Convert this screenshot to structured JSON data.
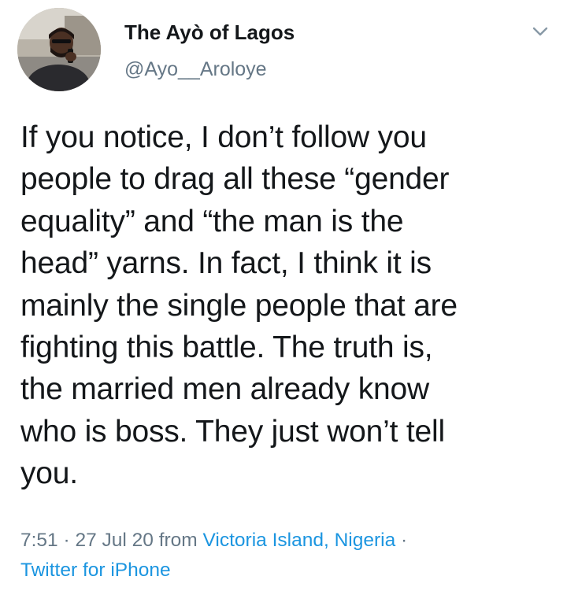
{
  "user": {
    "display_name": "The Ayò of Lagos",
    "handle": "@Ayo__Aroloye"
  },
  "tweet": {
    "lines": [
      "If you notice, I don’t follow you",
      "people to drag all these “gender",
      "equality” and “the man is the",
      "head” yarns. In fact, I think it is",
      "mainly the single people that are",
      "fighting this battle. The truth is,",
      "the married men already know",
      "who is boss. They just won’t tell",
      "you."
    ]
  },
  "meta": {
    "time": "7:51",
    "sep1": " · ",
    "date": "27 Jul 20",
    "from_text": " from ",
    "location": "Victoria Island, Nigeria",
    "sep2": " ·",
    "client": "Twitter for iPhone"
  },
  "icons": {
    "menu": "chevron-down-icon"
  },
  "colors": {
    "text": "#14171a",
    "secondary": "#657786",
    "link": "#1b95e0",
    "background": "#ffffff"
  }
}
